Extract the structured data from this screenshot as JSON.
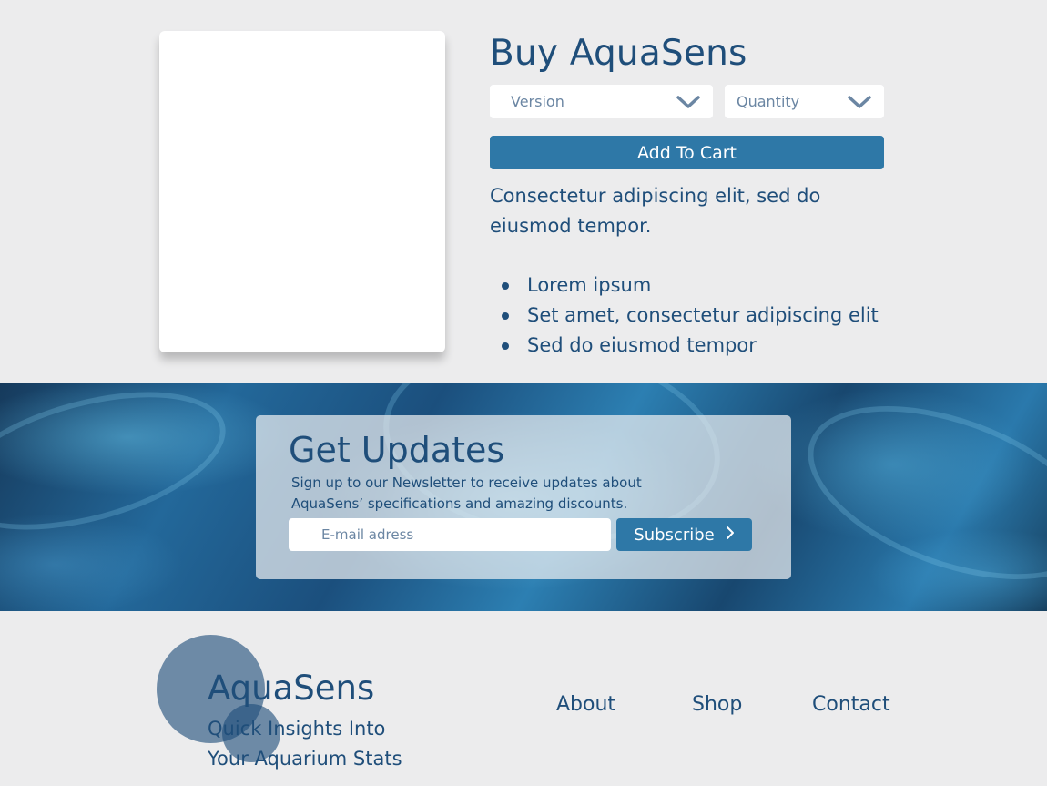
{
  "product": {
    "title": "Buy AquaSens",
    "version_select": {
      "placeholder": "Version",
      "icon": "chevron-down-icon"
    },
    "quantity_select": {
      "placeholder": "Quantity",
      "icon": "chevron-down-icon"
    },
    "add_to_cart_label": "Add To Cart",
    "description": "Consectetur adipiscing elit, sed do eiusmod tempor.",
    "features": [
      "Lorem ipsum",
      "Set amet, consectetur adipiscing elit",
      "Sed do eiusmod tempor"
    ]
  },
  "newsletter": {
    "title": "Get Updates",
    "text_line1": "Sign up to our Newsletter to receive updates about",
    "text_line2": "AquaSens’ specifications and amazing discounts.",
    "email_placeholder": "E-mail adress",
    "subscribe_label": "Subscribe",
    "subscribe_icon": "chevron-right-icon"
  },
  "footer": {
    "brand": "AquaSens",
    "tagline_line1": "Quick Insights Into",
    "tagline_line2": "Your Aquarium Stats",
    "nav": [
      "About",
      "Shop",
      "Contact"
    ]
  },
  "colors": {
    "background": "#ececed",
    "primary_text": "#1f4e7a",
    "button": "#2e78a7",
    "placeholder": "#6b86a3"
  }
}
